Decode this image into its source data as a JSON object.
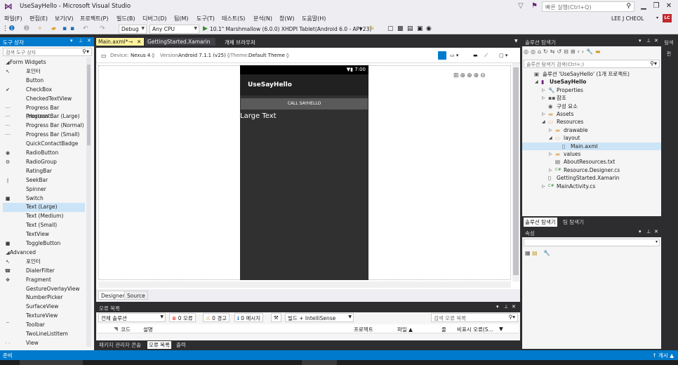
{
  "window": {
    "title": "UseSayHello - Microsoft Visual Studio",
    "quick_launch_placeholder": "빠른 실행(Ctrl+Q)",
    "user": "LEE J CHEOL",
    "avatar_initials": "LC"
  },
  "menu": [
    "파일(F)",
    "편집(E)",
    "보기(V)",
    "프로젝트(P)",
    "빌드(B)",
    "디버그(D)",
    "팀(M)",
    "도구(T)",
    "테스트(S)",
    "분석(N)",
    "창(W)",
    "도움말(H)"
  ],
  "toolbar": {
    "config": "Debug",
    "platform": "Any CPU",
    "run_target": "10.1\" Marshmallow (6.0.0) XHDPI Tablet(Android 6.0 - API 23)"
  },
  "toolbox": {
    "title": "도구 상자",
    "search_placeholder": "검색 도구 상자",
    "items": [
      {
        "label": "Form Widgets",
        "icon": "◢",
        "group": true
      },
      {
        "label": "포인터",
        "icon": "↖"
      },
      {
        "label": "Button",
        "icon": ""
      },
      {
        "label": "CheckBox",
        "icon": "✔"
      },
      {
        "label": "CheckedTextView",
        "icon": ""
      },
      {
        "label": "Progress Bar (Horizont...",
        "icon": "···"
      },
      {
        "label": "Progress Bar (Large)",
        "icon": "···"
      },
      {
        "label": "Progress Bar (Normal)",
        "icon": "···"
      },
      {
        "label": "Progress Bar (Small)",
        "icon": "···"
      },
      {
        "label": "QuickContactBadge",
        "icon": ""
      },
      {
        "label": "RadioButton",
        "icon": "◉"
      },
      {
        "label": "RadioGroup",
        "icon": "⚙"
      },
      {
        "label": "RatingBar",
        "icon": ""
      },
      {
        "label": "SeekBar",
        "icon": "ǀ"
      },
      {
        "label": "Spinner",
        "icon": ""
      },
      {
        "label": "Switch",
        "icon": "■"
      },
      {
        "label": "Text (Large)",
        "icon": "",
        "selected": true
      },
      {
        "label": "Text (Medium)",
        "icon": ""
      },
      {
        "label": "Text (Small)",
        "icon": ""
      },
      {
        "label": "TextView",
        "icon": ""
      },
      {
        "label": "ToggleButton",
        "icon": "■"
      },
      {
        "label": "Advanced",
        "icon": "◢",
        "group": true
      },
      {
        "label": "포인터",
        "icon": "↖"
      },
      {
        "label": "DialerFilter",
        "icon": "☎"
      },
      {
        "label": "Fragment",
        "icon": "✥"
      },
      {
        "label": "GestureOverlayView",
        "icon": ""
      },
      {
        "label": "NumberPicker",
        "icon": ""
      },
      {
        "label": "SurfaceView",
        "icon": ""
      },
      {
        "label": "TextureView",
        "icon": ""
      },
      {
        "label": "Toolbar",
        "icon": "‾"
      },
      {
        "label": "TwoLineListItem",
        "icon": ""
      },
      {
        "label": "View",
        "icon": "· ·"
      }
    ]
  },
  "doc_tabs": [
    {
      "label": "Main.axml*",
      "active": true
    },
    {
      "label": "GettingStarted.Xamarin",
      "active": false
    },
    {
      "label": "개체 브라우저",
      "active": false
    }
  ],
  "designer": {
    "device_label": "Device:",
    "device": "Nexus 4 ◊",
    "version_label": "Version:",
    "version": "Android 7.1.1 (v25) ◊",
    "theme_label": "Theme:",
    "theme": "Default Theme ◊",
    "tabs": [
      "Designer",
      "Source"
    ]
  },
  "phone": {
    "time": "7:00",
    "app_title": "UseSayHello",
    "button_label": "CALL SAYHELLO",
    "large_text": "Large Text"
  },
  "error_list": {
    "title": "오류 목록",
    "scope": "전체 솔루션",
    "errors": "0 오류",
    "warnings": "0 경고",
    "messages": "0 메시지",
    "build_filter": "빌드 + IntelliSense",
    "search_placeholder": "검색 오류 목록",
    "columns": [
      "코드",
      "설명",
      "프로젝트",
      "파일 ▲",
      "줄",
      "비표시 오류(S..."
    ]
  },
  "bottom_tabs": [
    "패키지 관리자 콘솔",
    "오류 목록",
    "출력"
  ],
  "solution_explorer": {
    "title": "솔루션 탐색기",
    "search_placeholder": "솔루션 탐색기 검색(Ctrl+;)",
    "items": [
      {
        "label": "솔루션 'UseSayHello' (1개 프로젝트)",
        "indent": 0,
        "exp": "",
        "icon": "▣"
      },
      {
        "label": "UseSayHello",
        "indent": 1,
        "exp": "◢",
        "icon": "▮",
        "bold": true
      },
      {
        "label": "Properties",
        "indent": 2,
        "exp": "▷",
        "icon": "🔧"
      },
      {
        "label": "참조",
        "indent": 2,
        "exp": "▷",
        "icon": "▪▪"
      },
      {
        "label": "구성 요소",
        "indent": 2,
        "exp": "",
        "icon": "◉"
      },
      {
        "label": "Assets",
        "indent": 2,
        "exp": "▷",
        "icon": "▬"
      },
      {
        "label": "Resources",
        "indent": 2,
        "exp": "◢",
        "icon": "▭"
      },
      {
        "label": "drawable",
        "indent": 3,
        "exp": "▷",
        "icon": "▬"
      },
      {
        "label": "layout",
        "indent": 3,
        "exp": "◢",
        "icon": "▭"
      },
      {
        "label": "Main.axml",
        "indent": 4,
        "exp": "",
        "icon": "▯",
        "selected": true
      },
      {
        "label": "values",
        "indent": 3,
        "exp": "▷",
        "icon": "▬"
      },
      {
        "label": "AboutResources.txt",
        "indent": 3,
        "exp": "",
        "icon": "▤"
      },
      {
        "label": "Resource.Designer.cs",
        "indent": 3,
        "exp": "▷",
        "icon": "C#"
      },
      {
        "label": "GettingStarted.Xamarin",
        "indent": 2,
        "exp": "",
        "icon": "▯"
      },
      {
        "label": "MainActivity.cs",
        "indent": 2,
        "exp": "▷",
        "icon": "C#"
      }
    ],
    "tabs": [
      "솔루션 탐색기",
      "팀 탐색기"
    ]
  },
  "properties": {
    "title": "속성"
  },
  "side_gutter": [
    "탐색",
    "편"
  ],
  "status": {
    "left": "준비",
    "right": "↑ 게시 ▲"
  }
}
